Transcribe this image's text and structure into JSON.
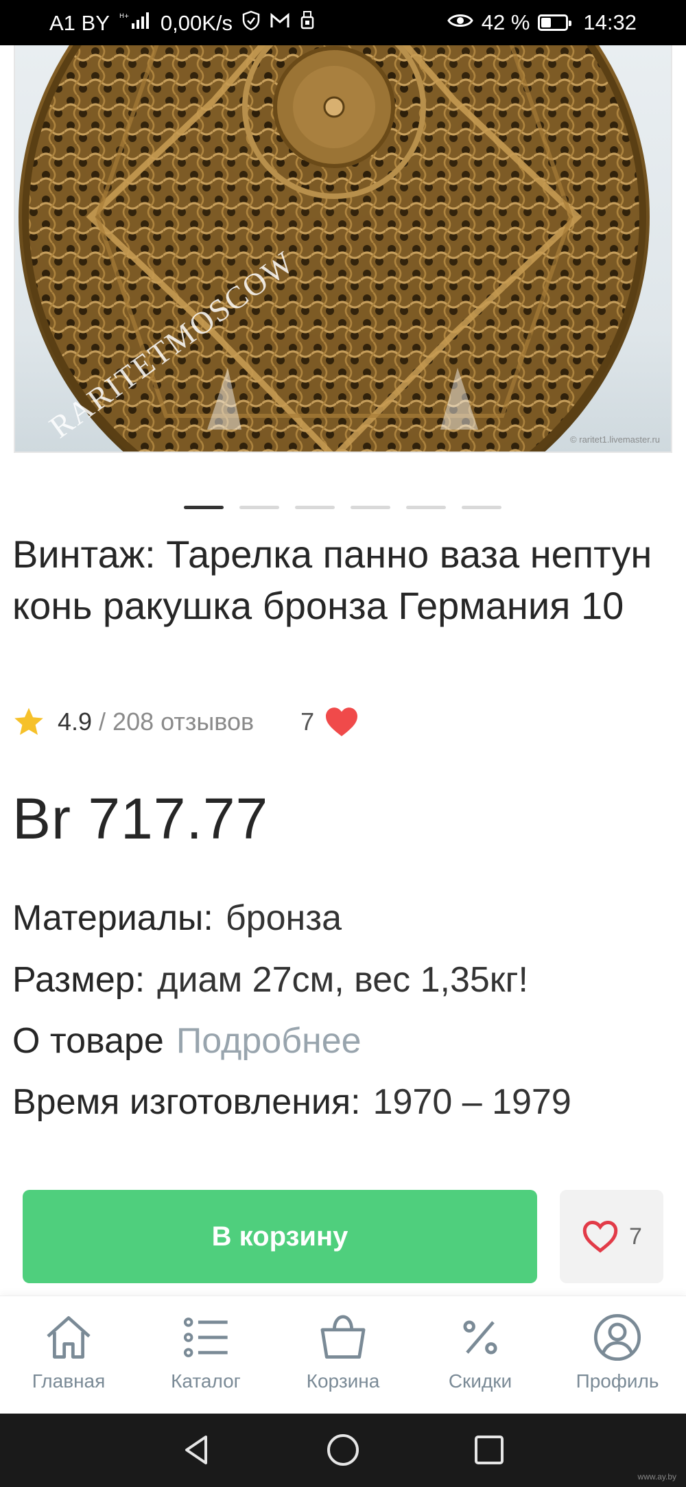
{
  "status_bar": {
    "carrier": "A1 BY",
    "net_speed": "0,00K/s",
    "battery_percent": "42 %",
    "battery_level": 0.42,
    "time": "14:32",
    "icons": [
      "signal-icon",
      "shield-icon",
      "mail-icon",
      "usb-icon",
      "eye-icon",
      "battery-icon"
    ]
  },
  "product": {
    "image": {
      "watermark": "RARITETMOSCOW",
      "credit": "© raritet1.livemaster.ru"
    },
    "carousel": {
      "total": 6,
      "active_index": 0
    },
    "title": "Винтаж: Тарелка панно ваза нептун конь ракушка бронза Германия 10",
    "rating": {
      "value": "4.9",
      "reviews": "/ 208 отзывов",
      "likes": "7"
    },
    "price": "Br 717.77",
    "attributes": {
      "materials_label": "Материалы:",
      "materials_value": "бронза",
      "size_label": "Размер:",
      "size_value": "диам 27см, вес 1,35кг!",
      "about_label": "О товаре",
      "about_link": "Подробнее",
      "time_label": "Время изготовления:",
      "time_value": "1970 – 1979"
    }
  },
  "actions": {
    "cart_button": "В корзину",
    "favorite_count": "7"
  },
  "bottom_nav": {
    "items": [
      {
        "label": "Главная",
        "icon": "home-icon"
      },
      {
        "label": "Каталог",
        "icon": "list-icon"
      },
      {
        "label": "Корзина",
        "icon": "basket-icon"
      },
      {
        "label": "Скидки",
        "icon": "percent-icon"
      },
      {
        "label": "Профиль",
        "icon": "profile-icon"
      }
    ]
  },
  "system_nav": {
    "watermark": "www.ay.by"
  },
  "colors": {
    "accent_green": "#4fcf7d",
    "heart_red": "#f04a4a",
    "star_yellow": "#f6c12a",
    "muted_text": "#98a4ad"
  }
}
